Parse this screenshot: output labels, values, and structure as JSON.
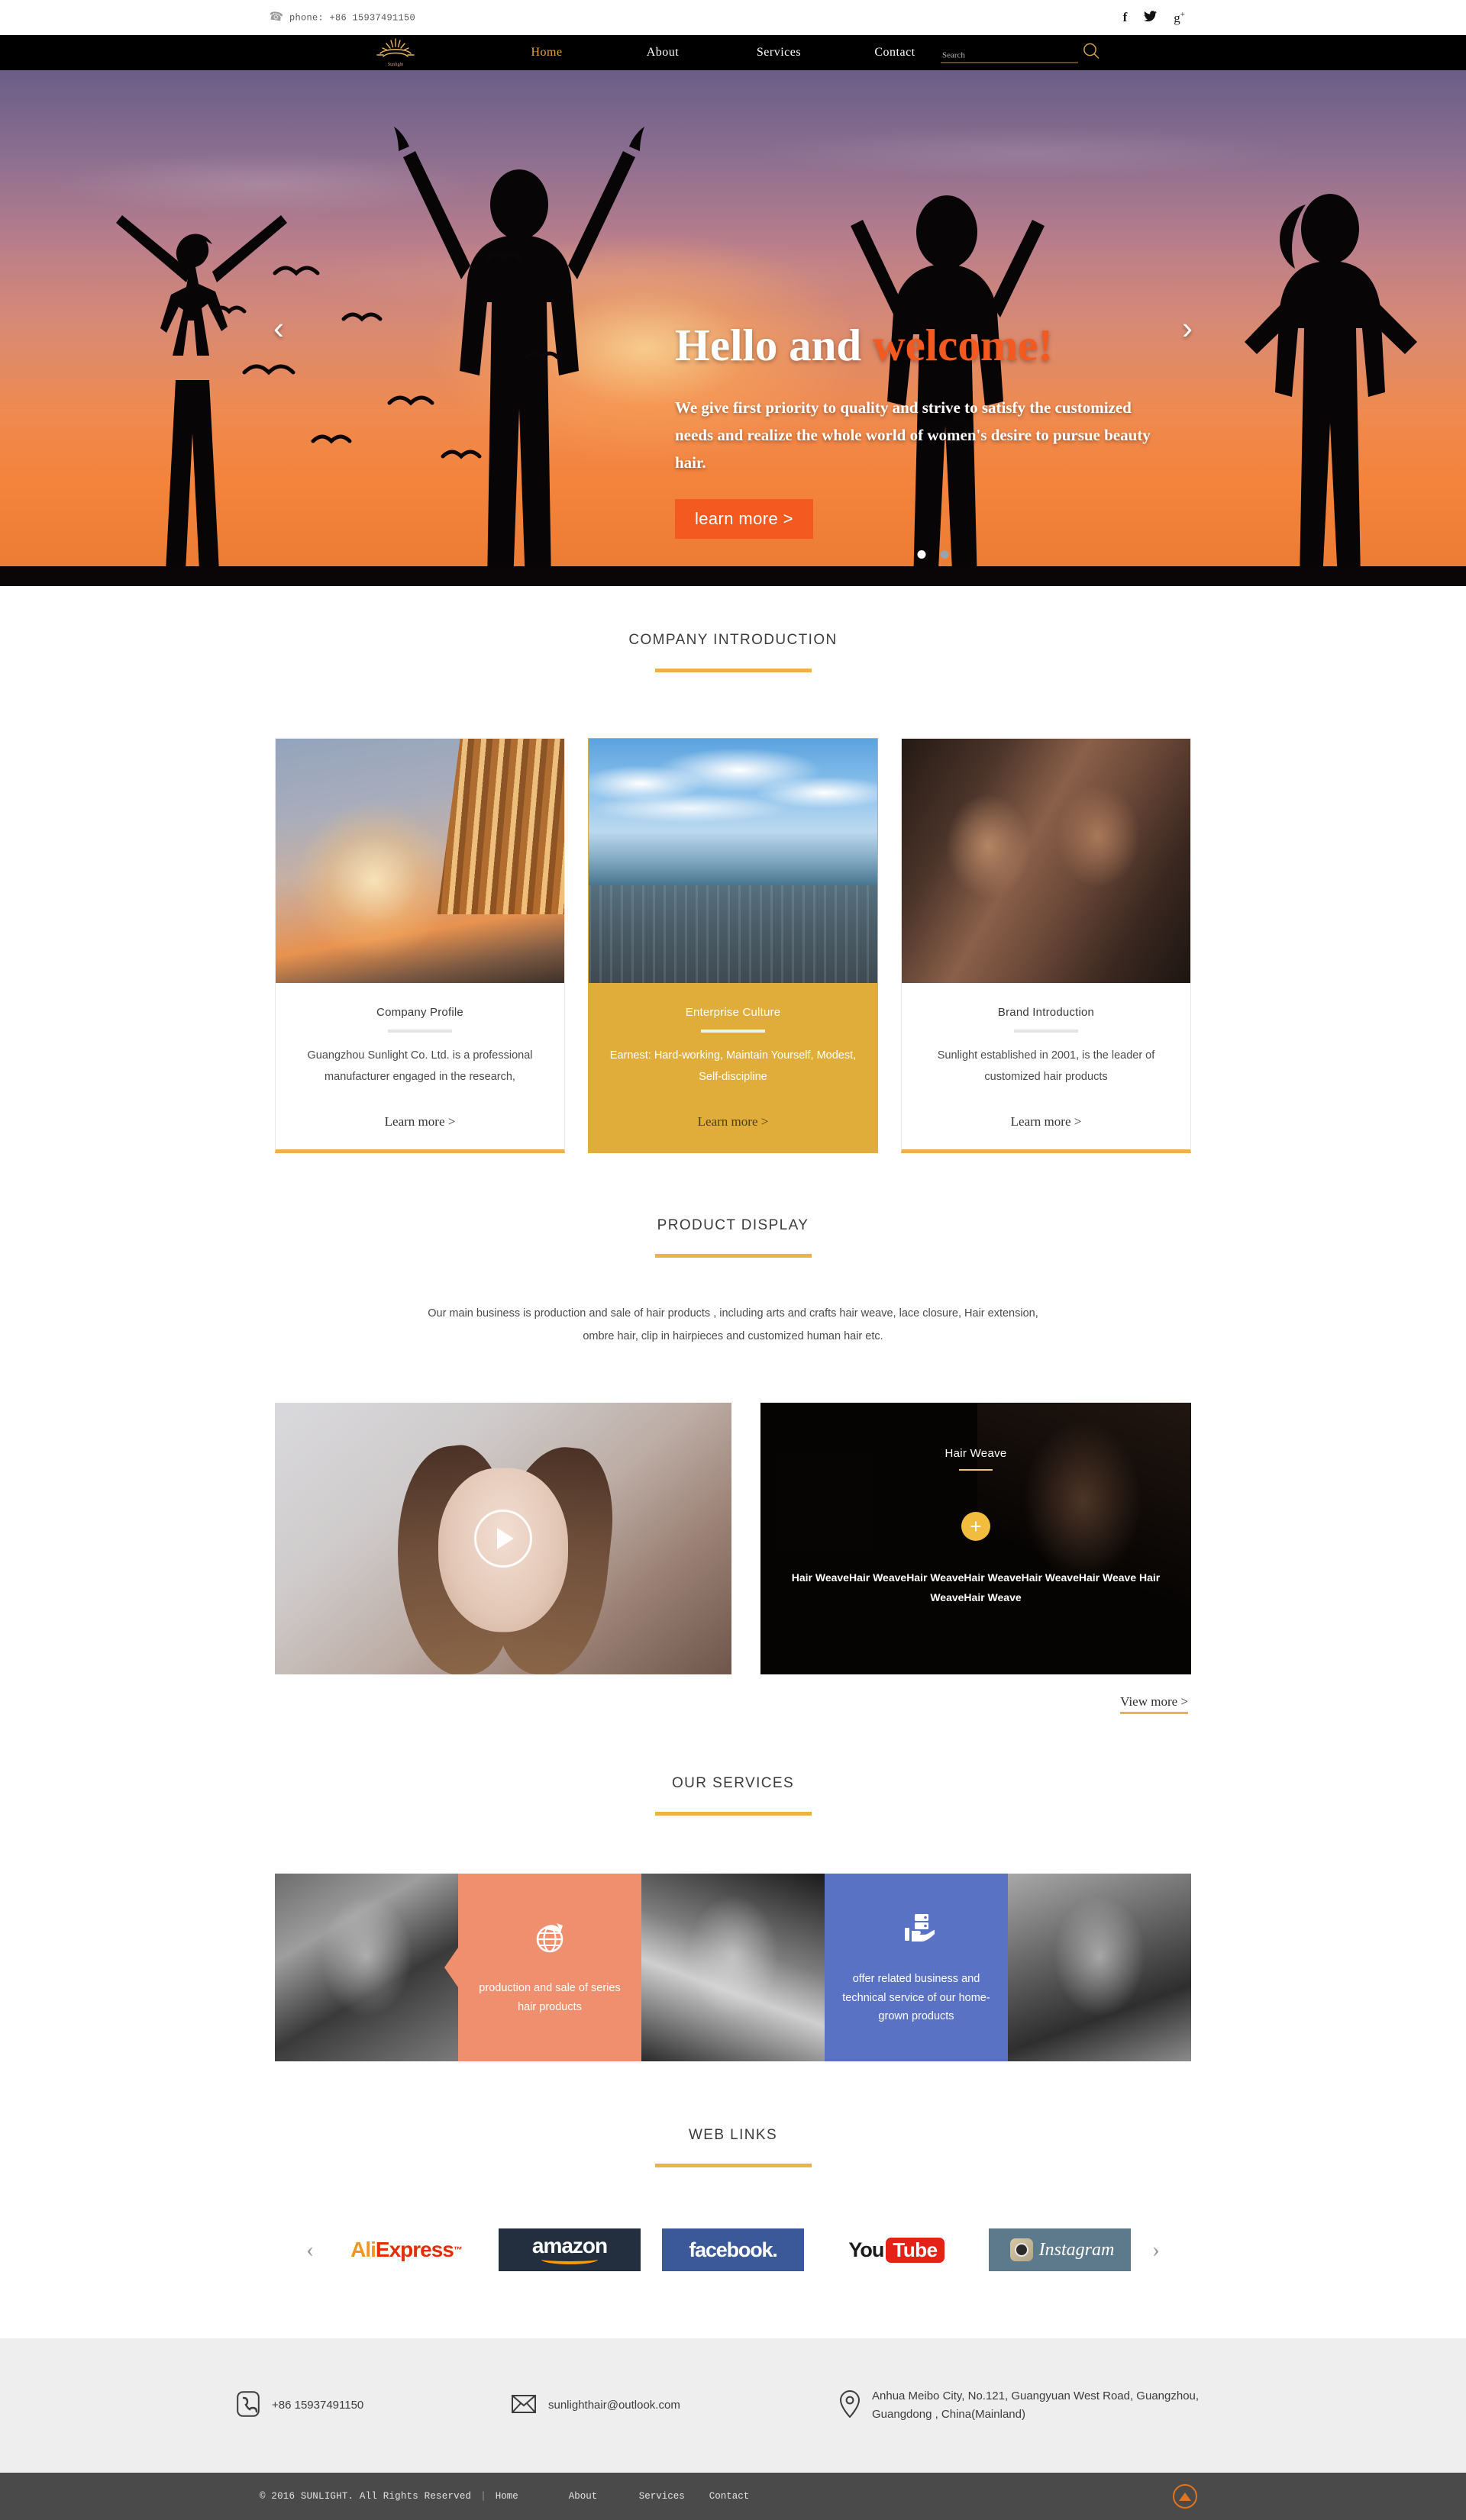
{
  "topbar": {
    "phone_icon": "phone-icon",
    "phone": "phone: +86 15937491150",
    "social": [
      {
        "name": "facebook-icon",
        "glyph": "f"
      },
      {
        "name": "twitter-icon",
        "glyph": "✈"
      },
      {
        "name": "google-plus-icon",
        "glyph": "g+"
      }
    ]
  },
  "nav": {
    "logo_alt": "Sunlight",
    "items": [
      {
        "label": "Home",
        "active": true
      },
      {
        "label": "About",
        "active": false
      },
      {
        "label": "Services",
        "active": false
      },
      {
        "label": "Contact",
        "active": false
      }
    ],
    "search_placeholder": "Search",
    "search_value": "",
    "search_icon": "search-icon"
  },
  "hero": {
    "title_plain": "Hello and ",
    "title_accent": "welcome!",
    "subtitle": "We give first priority to quality and strive to satisfy the customized needs and realize the whole world of women's desire to pursue beauty hair.",
    "button": "learn more  >",
    "prev_icon": "chevron-left-icon",
    "next_icon": "chevron-right-icon",
    "slides": 2,
    "active_slide": 1
  },
  "company": {
    "heading": "COMPANY INTRODUCTION",
    "cards": [
      {
        "title": "Company Profile",
        "desc": "Guangzhou Sunlight Co. Ltd. is a professional manufacturer engaged in the research,",
        "more": "Learn more >",
        "highlight": false,
        "image": "office-building-sunset-photo"
      },
      {
        "title": "Enterprise Culture",
        "desc": "Earnest: Hard-working, Maintain Yourself, Modest, Self-discipline",
        "more": "Learn more >",
        "highlight": true,
        "image": "aerial-coastal-city-photo"
      },
      {
        "title": "Brand Introduction",
        "desc": "Sunlight established in 2001, is the leader of customized hair products",
        "more": "Learn more >",
        "highlight": false,
        "image": "two-smiling-models-photo"
      }
    ]
  },
  "product": {
    "heading": "PRODUCT DISPLAY",
    "description": "Our main business is production and sale of hair products , including arts and crafts hair weave, lace closure, Hair extension, ombre hair, clip in hairpieces and customized human hair etc.",
    "video": {
      "name": "product-video",
      "play_icon": "play-icon"
    },
    "tile": {
      "title": "Hair Weave",
      "plus_icon": "plus-icon",
      "text": "Hair WeaveHair WeaveHair WeaveHair WeaveHair WeaveHair Weave Hair WeaveHair Weave"
    },
    "view_more": "View more >"
  },
  "services": {
    "heading": "OUR SERVICES",
    "panels": [
      {
        "icon": "globe-arrow-icon",
        "text": "production and sale of series hair products",
        "color": "#ef8f6e"
      },
      {
        "icon": "hand-service-icon",
        "text": "offer related business and technical service of our home-grown products",
        "color": "#5a72c4"
      }
    ],
    "photos": [
      "model-bw-photo-1",
      "model-bw-photo-2",
      "model-braids-photo"
    ]
  },
  "weblinks": {
    "heading": "WEB LINKS",
    "prev_icon": "chevron-left-icon",
    "next_icon": "chevron-right-icon",
    "items": [
      {
        "name": "aliexpress-logo",
        "part1": "Ali",
        "part2": "Express",
        "sup": "™"
      },
      {
        "name": "amazon-logo",
        "text": "amazon"
      },
      {
        "name": "facebook-logo",
        "text": "facebook."
      },
      {
        "name": "youtube-logo",
        "part1": "You",
        "part2": "Tube"
      },
      {
        "name": "instagram-logo",
        "text": "Instagram"
      }
    ]
  },
  "footer": {
    "contact": [
      {
        "icon": "phone-icon",
        "value": "+86 15937491150"
      },
      {
        "icon": "mail-icon",
        "value": "sunlighthair@outlook.com"
      },
      {
        "icon": "location-icon",
        "value": "Anhua Meibo City, No.121, Guangyuan West Road, Guangzhou, Guangdong , China(Mainland)"
      }
    ],
    "copyright": "© 2016 SUNLIGHT. All Rights Reserved",
    "divider": "|",
    "links": [
      "Home",
      "About",
      "Services",
      "Contact"
    ],
    "back_to_top_icon": "back-to-top-icon"
  },
  "colors": {
    "accent_gold": "#eeb148",
    "accent_orange": "#f4591f",
    "card_gold": "#e0ad3b",
    "service_orange": "#ef8f6e",
    "service_blue": "#5a72c4",
    "footer_gray": "#4a4a4a",
    "contact_gray": "#eeeeee"
  }
}
